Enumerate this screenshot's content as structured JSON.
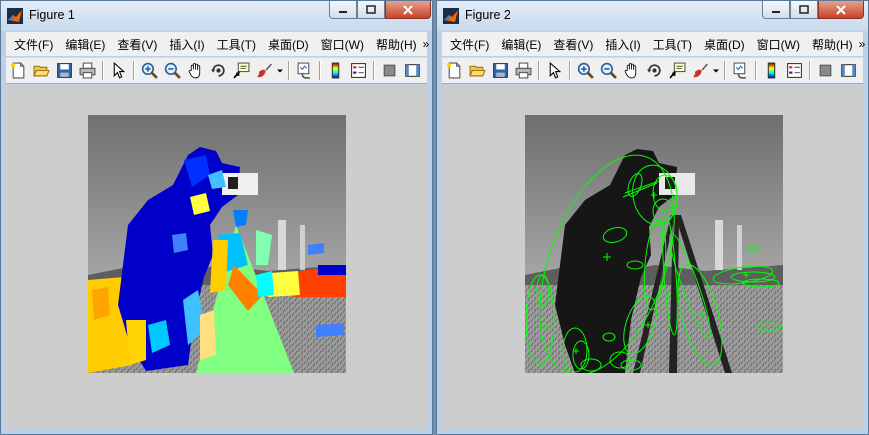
{
  "windows": [
    {
      "title": "Figure 1",
      "menu": [
        "文件(F)",
        "编辑(E)",
        "查看(V)",
        "插入(I)",
        "工具(T)",
        "桌面(D)",
        "窗口(W)",
        "帮助(H)"
      ],
      "menu_overflow": "»"
    },
    {
      "title": "Figure 2",
      "menu": [
        "文件(F)",
        "编辑(E)",
        "查看(V)",
        "插入(I)",
        "工具(T)",
        "桌面(D)",
        "窗口(W)",
        "帮助(H)"
      ],
      "menu_overflow": "»"
    }
  ],
  "toolbar_icons": [
    "new-figure-icon",
    "open-file-icon",
    "save-icon",
    "print-icon",
    "edit-plot-arrow-icon",
    "zoom-in-icon",
    "zoom-out-icon",
    "pan-hand-icon",
    "rotate-3d-icon",
    "data-cursor-icon",
    "brush-icon",
    "brush-dropdown-icon",
    "link-plot-icon",
    "insert-colorbar-icon",
    "insert-legend-icon",
    "hide-plot-tools-icon",
    "show-plot-tools-icon"
  ],
  "colors": {
    "segment_palette": [
      "#0000c8",
      "#ffcc00",
      "#80ff80",
      "#00c0ff",
      "#ff4000",
      "#ffff40",
      "#4080ff",
      "#ff8000"
    ],
    "ellipse_stroke": "#00ff00",
    "figure_background": "#cdcdcd"
  }
}
